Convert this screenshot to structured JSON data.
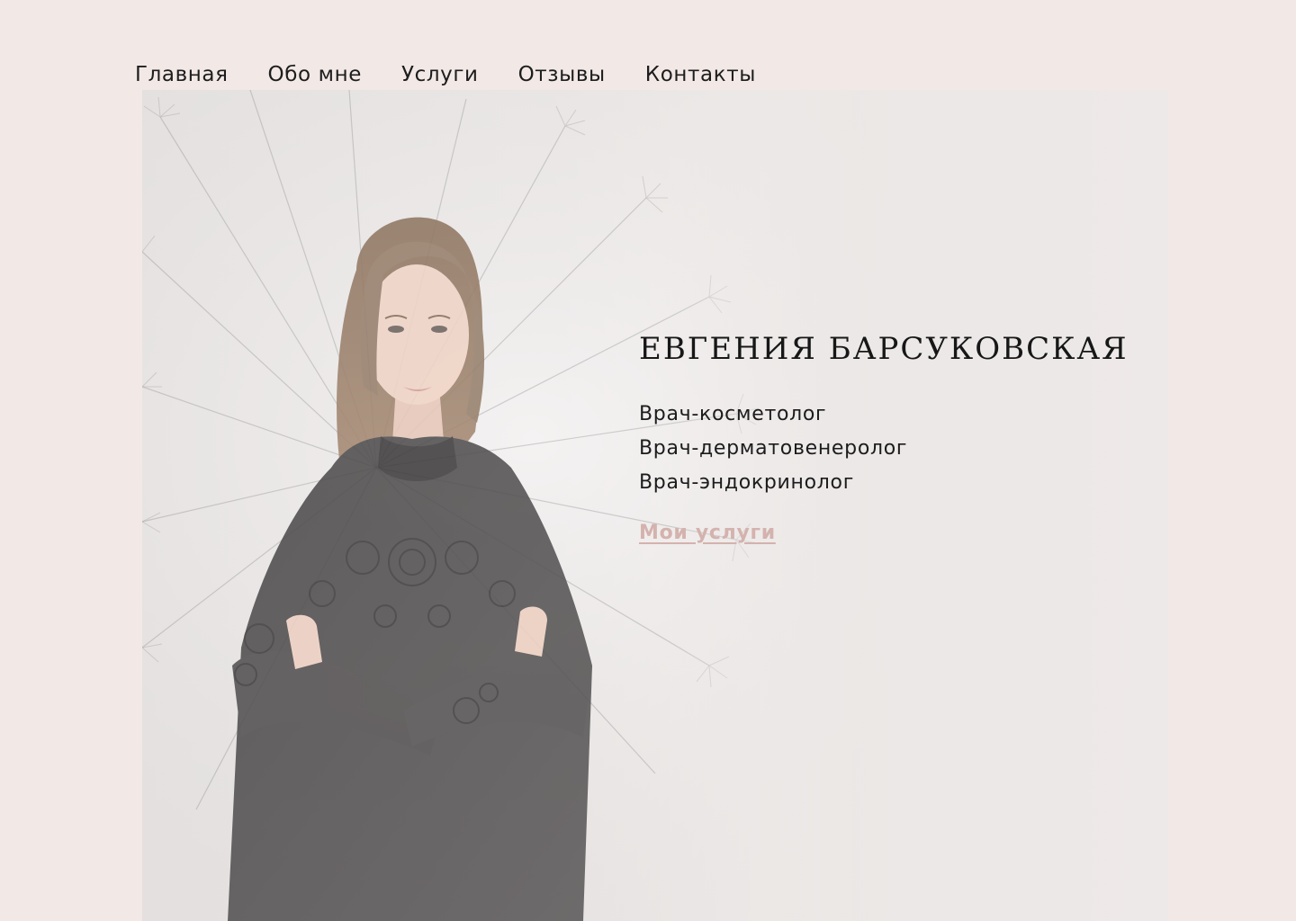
{
  "nav": {
    "items": [
      {
        "label": "Главная"
      },
      {
        "label": "Обо мне"
      },
      {
        "label": "Услуги"
      },
      {
        "label": "Отзывы"
      },
      {
        "label": "Контакты"
      }
    ]
  },
  "hero": {
    "name": "ЕВГЕНИЯ БАРСУКОВСКАЯ",
    "specialties": [
      "Врач-косметолог",
      "Врач-дерматовенеролог",
      "Врач-эндокринолог"
    ],
    "cta_label": "Мои услуги",
    "photo_icon": "portrait-photo"
  },
  "colors": {
    "page_bg": "#f2e8e6",
    "accent": "#d4b2ae",
    "text": "#1b1b1b"
  }
}
